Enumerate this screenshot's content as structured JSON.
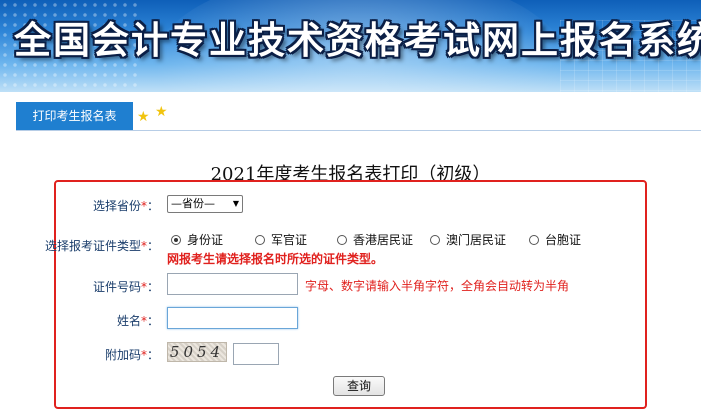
{
  "banner": {
    "title": "全国会计专业技术资格考试网上报名系统"
  },
  "tab": {
    "label": "打印考生报名表"
  },
  "form": {
    "title": "2021年度考生报名表打印（初级）",
    "province": {
      "label": "选择省份",
      "value": "—省份—"
    },
    "cert_type": {
      "label": "选择报考证件类型",
      "options": [
        "身份证",
        "军官证",
        "香港居民证",
        "澳门居民证",
        "台胞证"
      ],
      "selected": "身份证",
      "warning": "网报考生请选择报名时所选的证件类型。"
    },
    "cert_number": {
      "label": "证件号码",
      "value": "",
      "hint": "字母、数字请输入半角字符，全角会自动转为半角"
    },
    "name": {
      "label": "姓名",
      "value": ""
    },
    "captcha": {
      "label": "附加码",
      "image_text": "5054",
      "value": ""
    },
    "submit_label": "查询",
    "required_mark": "*",
    "label_suffix": "："
  }
}
